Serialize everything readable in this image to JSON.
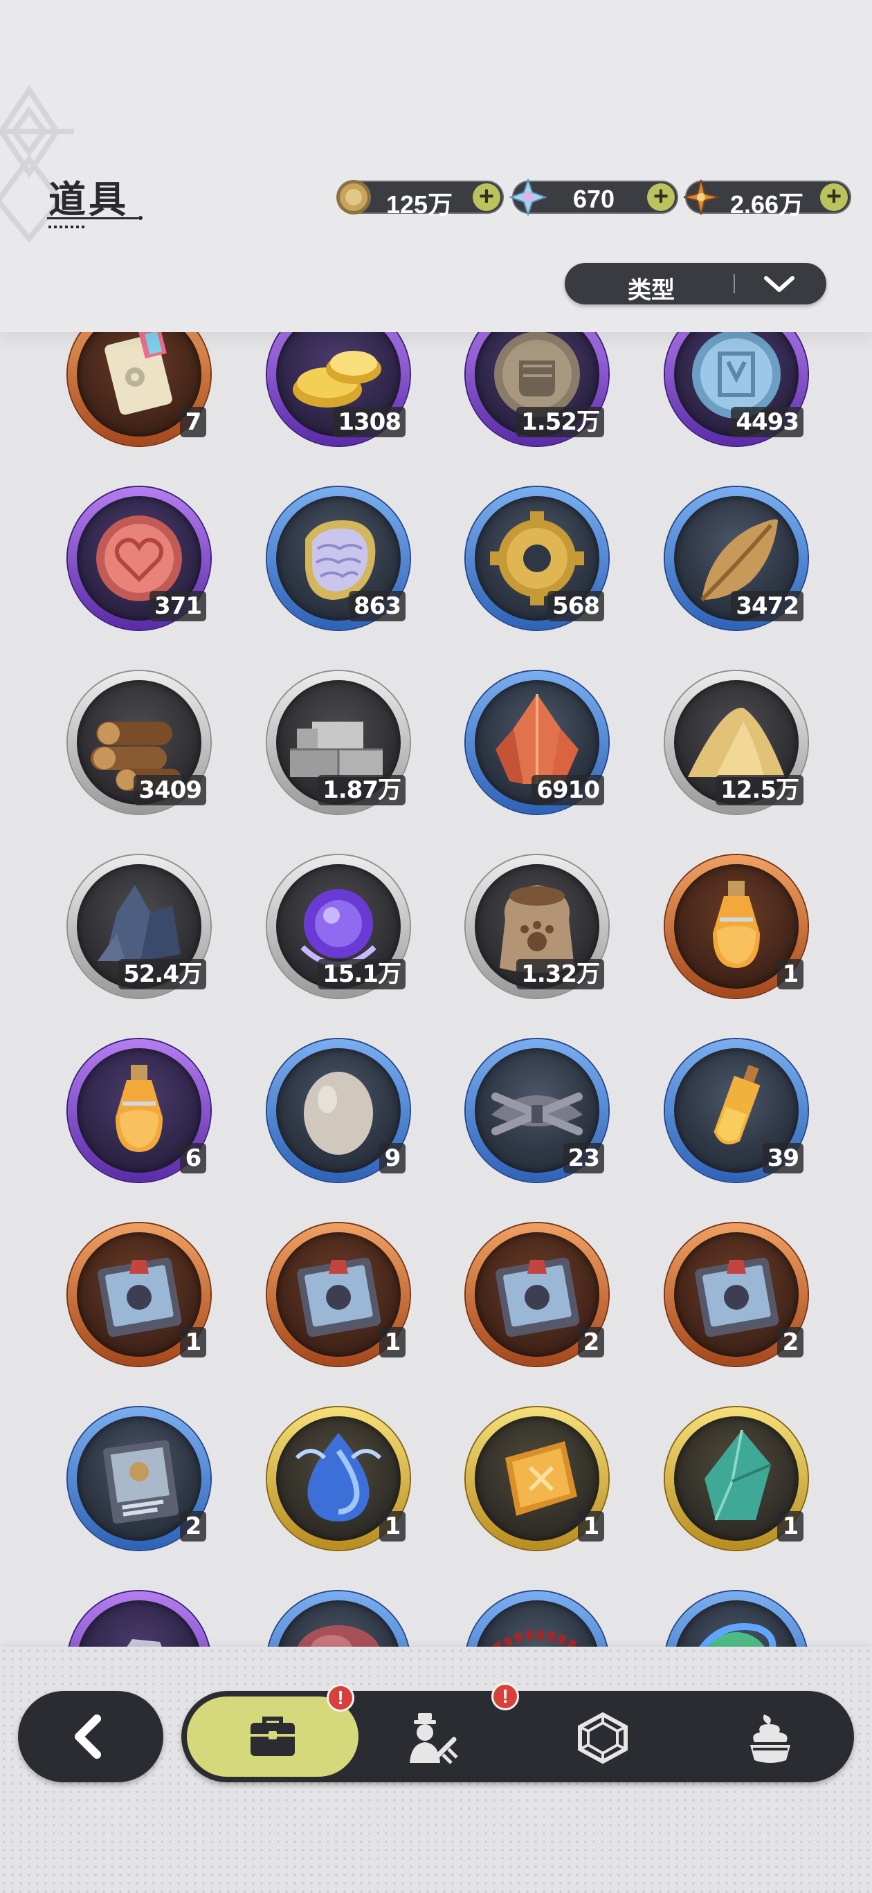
{
  "header": {
    "title": "道具",
    "currencies": [
      {
        "icon": "gold-coin-icon",
        "value": "125万"
      },
      {
        "icon": "crystal-icon",
        "value": "670"
      },
      {
        "icon": "star-gem-icon",
        "value": "2.66万"
      }
    ],
    "add_symbol": "+",
    "filter": {
      "label": "类型",
      "icon": "chevron-down-icon"
    }
  },
  "items": [
    {
      "icon": "ticket-icon",
      "rarity": "orange",
      "qty": "7"
    },
    {
      "icon": "gold-ingot-icon",
      "rarity": "purple",
      "qty": "1308"
    },
    {
      "icon": "fist-coin-icon",
      "rarity": "purple",
      "qty": "1.52万"
    },
    {
      "icon": "blue-rune-coin-icon",
      "rarity": "purple",
      "qty": "4493"
    },
    {
      "icon": "heart-coin-icon",
      "rarity": "purple",
      "qty": "371"
    },
    {
      "icon": "scale-amulet-icon",
      "rarity": "blue",
      "qty": "863"
    },
    {
      "icon": "gear-coin-icon",
      "rarity": "blue",
      "qty": "568"
    },
    {
      "icon": "leaf-icon",
      "rarity": "blue",
      "qty": "3472"
    },
    {
      "icon": "wood-logs-icon",
      "rarity": "gray",
      "qty": "3409"
    },
    {
      "icon": "stone-bricks-icon",
      "rarity": "gray",
      "qty": "1.87万"
    },
    {
      "icon": "red-crystal-icon",
      "rarity": "blue",
      "qty": "6910"
    },
    {
      "icon": "sand-pile-icon",
      "rarity": "gray",
      "qty": "12.5万"
    },
    {
      "icon": "dark-ore-icon",
      "rarity": "gray",
      "qty": "52.4万"
    },
    {
      "icon": "purple-orb-icon",
      "rarity": "gray",
      "qty": "15.1万"
    },
    {
      "icon": "paw-sack-icon",
      "rarity": "gray",
      "qty": "1.32万"
    },
    {
      "icon": "potion-bottle-icon",
      "rarity": "orange",
      "qty": "1"
    },
    {
      "icon": "potion-bottle-icon",
      "rarity": "purple",
      "qty": "6"
    },
    {
      "icon": "egg-icon",
      "rarity": "blue",
      "qty": "9"
    },
    {
      "icon": "feather-bundle-icon",
      "rarity": "blue",
      "qty": "23"
    },
    {
      "icon": "potion-vial-icon",
      "rarity": "blue",
      "qty": "39"
    },
    {
      "icon": "gift-book-icon",
      "rarity": "orange",
      "qty": "1"
    },
    {
      "icon": "gift-book-icon",
      "rarity": "orange",
      "qty": "1"
    },
    {
      "icon": "gift-book-icon",
      "rarity": "orange",
      "qty": "2"
    },
    {
      "icon": "gift-book-icon",
      "rarity": "orange",
      "qty": "2"
    },
    {
      "icon": "card-book-icon",
      "rarity": "blue",
      "qty": "2"
    },
    {
      "icon": "water-drop-icon",
      "rarity": "gold",
      "qty": "1"
    },
    {
      "icon": "gold-emblem-icon",
      "rarity": "gold",
      "qty": "1"
    },
    {
      "icon": "green-crystal-icon",
      "rarity": "gold",
      "qty": "1"
    },
    {
      "icon": "silver-ore-icon",
      "rarity": "purple",
      "qty": ""
    },
    {
      "icon": "meat-icon",
      "rarity": "blue",
      "qty": ""
    },
    {
      "icon": "red-rope-icon",
      "rarity": "blue",
      "qty": ""
    },
    {
      "icon": "green-orb-icon",
      "rarity": "blue",
      "qty": ""
    }
  ],
  "nav": {
    "back_icon": "back-arrow-icon",
    "tabs": [
      {
        "icon": "bag-icon",
        "active": true,
        "alert": "!"
      },
      {
        "icon": "character-icon",
        "active": false,
        "alert": "!"
      },
      {
        "icon": "hexagon-gem-icon",
        "active": false,
        "alert": ""
      },
      {
        "icon": "dessert-icon",
        "active": false,
        "alert": ""
      }
    ]
  },
  "colors": {
    "ring_gray": "#b8b8b8",
    "ring_blue": "#4a86d8",
    "ring_purple": "#8a4fd8",
    "ring_orange": "#e07a3a",
    "ring_gold": "#e7c548",
    "nav_bg": "#2b2c31",
    "nav_active": "#d6d87c",
    "alert_red": "#d8403c",
    "plus_green": "#bcc35e"
  }
}
